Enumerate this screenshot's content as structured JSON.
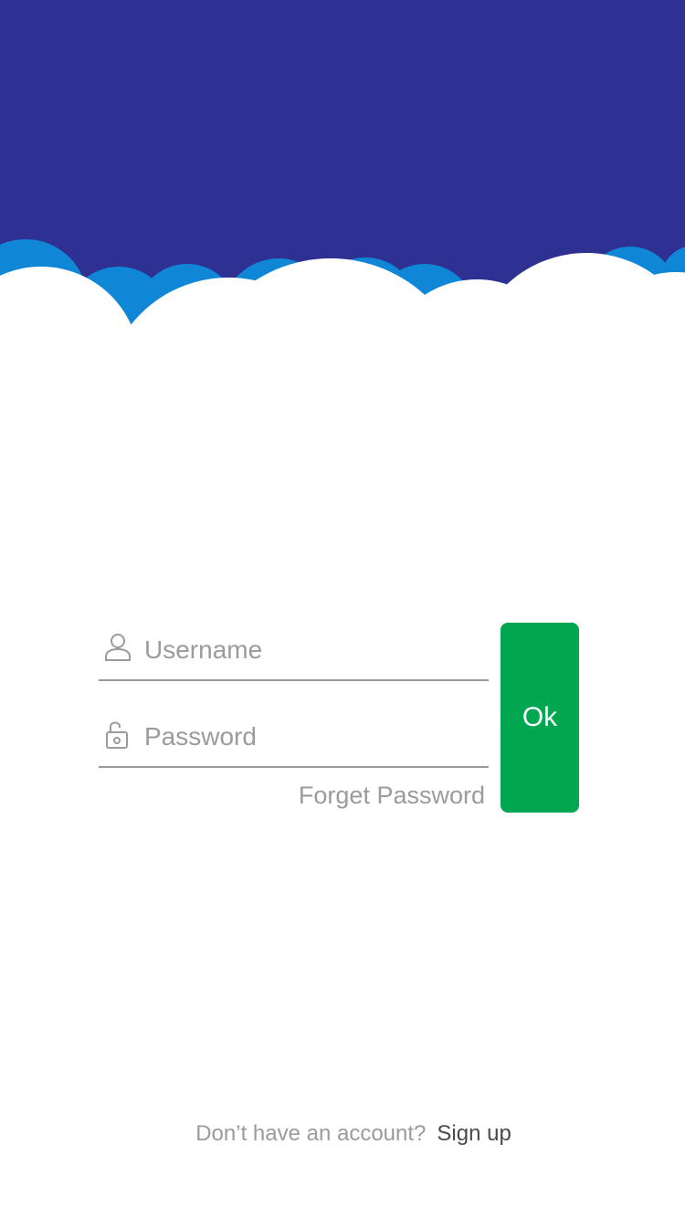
{
  "colors": {
    "header_background": "#2e3192",
    "cloud_back": "#0f86d6",
    "cloud_front": "#ffffff",
    "button_background": "#00a650",
    "button_text": "#ffffff",
    "placeholder_text": "#9b9b9b",
    "underline": "#9a9a9a",
    "link_text": "#4a4a4a"
  },
  "header": {
    "decoration": "clouds-illustration"
  },
  "login_form": {
    "username": {
      "icon": "user-icon",
      "placeholder": "Username",
      "value": ""
    },
    "password": {
      "icon": "unlock-icon",
      "placeholder": "Password",
      "value": ""
    },
    "forget_password_label": "Forget Password",
    "submit_label": "Ok"
  },
  "footer": {
    "prompt": "Don’t have an account?",
    "signup_label": "Sign up"
  }
}
